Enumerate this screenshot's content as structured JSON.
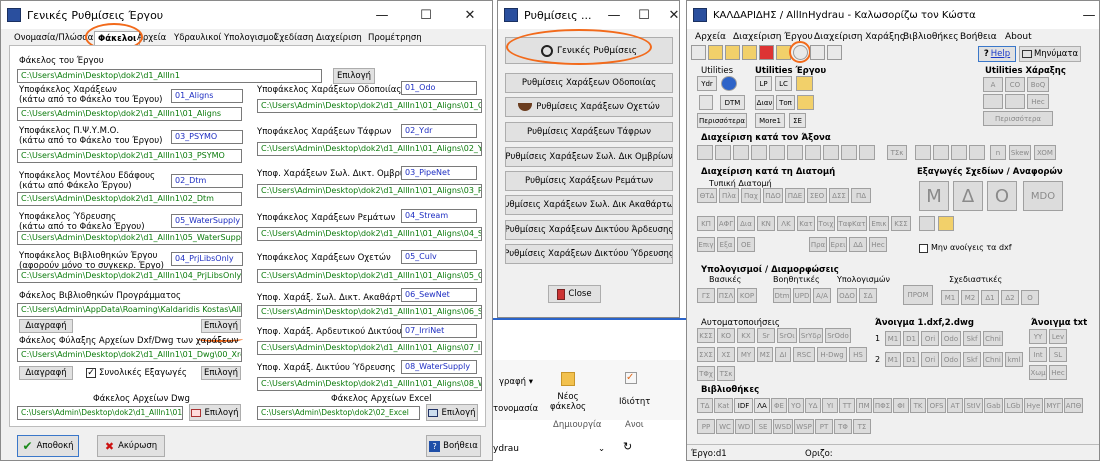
{
  "win1": {
    "title": "Γενικές Ρυθμίσεις Έργου",
    "tabs": [
      "Ονομασία/Πλώσσα",
      "Φάκελοι",
      "Αρχεία",
      "Υδραυλικοί Υπολογισμοί",
      "Σχεδίαση",
      "Διαχείριση",
      "Προμέτρηση"
    ],
    "project_folder_label": "Φάκελος του Έργου",
    "project_folder_value": "C:\\Users\\Admin\\Desktop\\dok2\\d1_AllIn1",
    "select_label": "Επιλογή",
    "left_fields": [
      {
        "label1": "Υποφάκελος Χαράξεων",
        "label2": "(κάτω από το Φάκελο του Έργου)",
        "name": "01_Aligns",
        "path": "C:\\Users\\Admin\\Desktop\\dok2\\d1_AllIn1\\01_Aligns"
      },
      {
        "label1": "Υποφάκελος Π.Ψ.Υ.Μ.Ο.",
        "label2": "(κάτω από το Φάκελο του Έργου)",
        "name": "03_PSYMO",
        "path": "C:\\Users\\Admin\\Desktop\\dok2\\d1_AllIn1\\03_PSYMO"
      },
      {
        "label1": "Υποφάκελος Μοντέλου Εδάφους",
        "label2": "(κάτω από Φάκελο Έργου)",
        "name": "02_Dtm",
        "path": "C:\\Users\\Admin\\Desktop\\dok2\\d1_AllIn1\\02_Dtm"
      },
      {
        "label1": "Υποφάκελος Ύδρευσης",
        "label2": "(κάτω από το Φάκελο Έργου)",
        "name": "05_WaterSupply",
        "path": "C:\\Users\\Admin\\Desktop\\dok2\\d1_AllIn1\\05_WaterSupply"
      },
      {
        "label1": "Υποφάκελος Βιβλιοθηκών Έργου",
        "label2": "(αφορούν μόνο το συγκεκρ. Έργο)",
        "name": "04_PrjLibsOnly",
        "path": "C:\\Users\\Admin\\Desktop\\dok2\\d1_AllIn1\\04_PrjLibsOnly"
      }
    ],
    "right_fields": [
      {
        "label": "Υποφάκελος Χαράξεων Οδοποιίας",
        "name": "01_Odo",
        "path": "C:\\Users\\Admin\\Desktop\\dok2\\d1_AllIn1\\01_Aligns\\01_Odo"
      },
      {
        "label": "Υποφάκελος Χαράξεων Τάφρων",
        "name": "02_Ydr",
        "path": "C:\\Users\\Admin\\Desktop\\dok2\\d1_AllIn1\\01_Aligns\\02_Ydr"
      },
      {
        "label": "Υποφ. Χαράξεων Σωλ. Δικτ. Ομβρίων",
        "name": "03_PipeNet",
        "path": "C:\\Users\\Admin\\Desktop\\dok2\\d1_AllIn1\\01_Aligns\\03_PipeNet"
      },
      {
        "label": "Υποφάκελος Χαράξεων Ρεμάτων",
        "name": "04_Stream",
        "path": "C:\\Users\\Admin\\Desktop\\dok2\\d1_AllIn1\\01_Aligns\\04_Stream"
      },
      {
        "label": "Υποφάκελος Χαράξεων Οχετών",
        "name": "05_Culv",
        "path": "C:\\Users\\Admin\\Desktop\\dok2\\d1_AllIn1\\01_Aligns\\05_Culv"
      },
      {
        "label": "Υποφ. Χαράξ. Σωλ. Δικτ. Ακαθάρτων",
        "name": "06_SewNet",
        "path": "C:\\Users\\Admin\\Desktop\\dok2\\d1_AllIn1\\01_Aligns\\06_SewNet"
      },
      {
        "label": "Υποφ. Χαράξ. Αρδευτικού Δικτύου",
        "name": "07_IrriNet",
        "path": "C:\\Users\\Admin\\Desktop\\dok2\\d1_AllIn1\\01_Aligns\\07_IrriNet"
      },
      {
        "label": "Υποφ. Χαράξ. Δικτύου Ύδρευσης",
        "name": "08_WaterSupply",
        "path": "C:\\Users\\Admin\\Desktop\\dok2\\d1_AllIn1\\01_Aligns\\08_WaterSupply"
      }
    ],
    "prog_lib_label": "Φάκελος Βιβλιοθηκών Προγράμματος",
    "prog_lib_value": "C:\\Users\\Admin\\AppData\\Roaming\\Kaldaridis Kostas\\AllInHydrau",
    "delete_label": "Διαγραφή",
    "dxf_label": "Φάκελος Φύλαξης Αρχείων Dxf/Dwg των χαράξεων",
    "dxf_value": "C:\\Users\\Admin\\Desktop\\dok2\\d1_AllIn1\\01_Dwg\\00_Xref",
    "combined_label": "Συνολικές Εξαγωγές",
    "dwg_label": "Φάκελος Αρχείων Dwg",
    "dwg_value": "C:\\Users\\Admin\\Desktop\\dok2\\d1_AllIn1\\01_Dwg",
    "excel_label": "Φάκελος Αρχείων Excel",
    "excel_value": "C:\\Users\\Admin\\Desktop\\dok2\\02_Excel",
    "save_label": "Αποθοκή",
    "cancel_label": "Ακύρωση",
    "help_label": "Βοήθεια"
  },
  "win2": {
    "title": "Ρυθμίσεις ...",
    "general_label": "Γενικές Ρυθμίσεις",
    "buttons": [
      "Ρυθμίσεις Χαράξεων Οδοποιίας",
      "Ρυθμίσεις Χαράξεων Οχετών",
      "Ρυθμίσεις Χαράξεων Τάφρων",
      "Ρυθμίσεις Χαράξεων Σωλ. Δικ Ομβρίων",
      "Ρυθμίσεις Χαράξεων Ρεμάτων",
      "Ρυθμίσεις Χαράξεων Σωλ. Δικ Ακαθάρτων",
      "Ρυθμίσεις Χαράξεων Δικτύου Άρδευσης",
      "Ρυθμίσεις Χαράξεων Δικτύου Ύδρευσης"
    ],
    "close_label": "Close"
  },
  "explorer": {
    "graph_label": "γραφή ▾",
    "new_folder": "Νέος φάκελος",
    "properties": "Ιδιότητ",
    "create_label": "Δημιουργία",
    "open_label": "Ανοι",
    "org_label": "τονομασία",
    "ydrau": "ydrau"
  },
  "win3": {
    "title": "ΚΑΛΔΑΡΙΔΗΣ / AllInHydrau - Καλωσορίζω τον Κώστα",
    "menu": [
      "Αρχεία",
      "Διαχείριση Έργου",
      "Διαχείριση Χαράξης",
      "Βιβλιοθήκες",
      "Βοήθεια",
      "About"
    ],
    "help_btn": "Help",
    "messages_btn": "Μηνύματα",
    "utilities_label": "Utilities",
    "utilities_project": "Utilities Έργου",
    "utilities_alignment": "Utilities Χάραξης",
    "util_btns": [
      "Ydr",
      "DTM",
      "Περισσότερα",
      "LP",
      "LC",
      "Διαν",
      "Τοπ",
      "More1",
      "ΣΕ"
    ],
    "align_btns": [
      "A",
      "CO",
      "BoQ",
      "Hec",
      "Περισσότερα"
    ],
    "axis_label": "Διαχείριση κατά τον Άξονα",
    "axis_btns": [
      "ΤΣκ",
      "n",
      "Skew",
      "XOM"
    ],
    "section_label": "Διαχείριση κατά τη Διατομή",
    "typical_label": "Τυπική Διατομή",
    "section_row1": [
      "ΘΤΔ",
      "Πλα",
      "Παχ",
      "ΠΔΟ",
      "ΠΔΕ",
      "ΣΕΟ",
      "ΔΣΣ",
      "ΠΔ"
    ],
    "section_row2": [
      "ΚΠ",
      "ΑΦΓ",
      "Δια",
      "ΚΝ",
      "ΛΚ",
      "Κατ",
      "Τοιχ",
      "ΤαφΚατ",
      "Επικ",
      "ΚΣΣ"
    ],
    "section_row3": [
      "Επιγ",
      "Εξα",
      "ΟΕ",
      "Πρα",
      "Ερει",
      "ΔΔ",
      "Hec"
    ],
    "export_label": "Εξαγωγές Σχεδίων / Αναφορών",
    "export_letters": [
      "M",
      "Δ",
      "Ο",
      "MDO"
    ],
    "no_dxf_label": "Μην ανοίγεις τα dxf",
    "calc_label": "Υπολογισμοί / Διαμορφώσεις",
    "basic_label": "Βασικές",
    "aux_label": "Βοηθητικές",
    "calcs_label": "Υπολογισμών",
    "drawing_label": "Σχεδιαστικές",
    "basic_btns": [
      "ΓΣ",
      "ΠΣΛ",
      "ΚΟΡ"
    ],
    "aux_btns": [
      "Dtm",
      "UPD",
      "Α/Α"
    ],
    "calc_btns": [
      "ΟΔΟ",
      "ΣΔ"
    ],
    "draw_btns": [
      "ΠΡΟΜ",
      "M1",
      "M2",
      "Δ1",
      "Δ2",
      "O"
    ],
    "auto_label": "Αυτοματοποιήσεις",
    "auto_row1": [
      "ΚΣΣ",
      "ΚΟ",
      "ΚΧ",
      "Sr",
      "SrΟι",
      "SrΥδρ",
      "SrOdo"
    ],
    "auto_row2": [
      "ΣΧΣ",
      "ΧΣ",
      "ΜΥ",
      "ΜΣ",
      "ΔΙ",
      "RSC",
      "H-Dwg",
      "HS"
    ],
    "auto_row3": [
      "ΤΦχ",
      "ΤΣκ"
    ],
    "open_dxf_label": "Άνοιγμα 1.dxf,2.dwg",
    "open_row1": [
      "1",
      "M1",
      "D1",
      "Ori",
      "Odo",
      "Skf",
      "Chni"
    ],
    "open_row2": [
      "2",
      "M1",
      "D1",
      "Ori",
      "Odo",
      "Skf",
      "Chni",
      "kml"
    ],
    "open_txt_label": "Άνοιγμα txt",
    "txt_btns": [
      "YY",
      "Lev",
      "Int",
      "SL",
      "Χωμ",
      "Hec"
    ],
    "libs_label": "Βιβλιοθήκες",
    "libs_row1": [
      "ΤΔ",
      "Kat",
      "IDF",
      "ΛΑ",
      "ΦΕ",
      "ΥΟ",
      "ΥΔ",
      "ΥΙ",
      "ΤΤ",
      "ΠΜ",
      "ΠΦΣ",
      "ΦΙ",
      "ΤΚ",
      "ΟFS",
      "ΑΤ",
      "StIV",
      "Gab",
      "LGb",
      "Hye",
      "ΜΥΓ",
      "ΑΠΘ"
    ],
    "libs_row2": [
      "PP",
      "WC",
      "WD",
      "SE",
      "WSD",
      "WSP",
      "ΡΤ",
      "ΤΦ",
      "ΤΣ"
    ],
    "status_project": "Έργο:d1",
    "status_limit": "Οριζο:"
  }
}
